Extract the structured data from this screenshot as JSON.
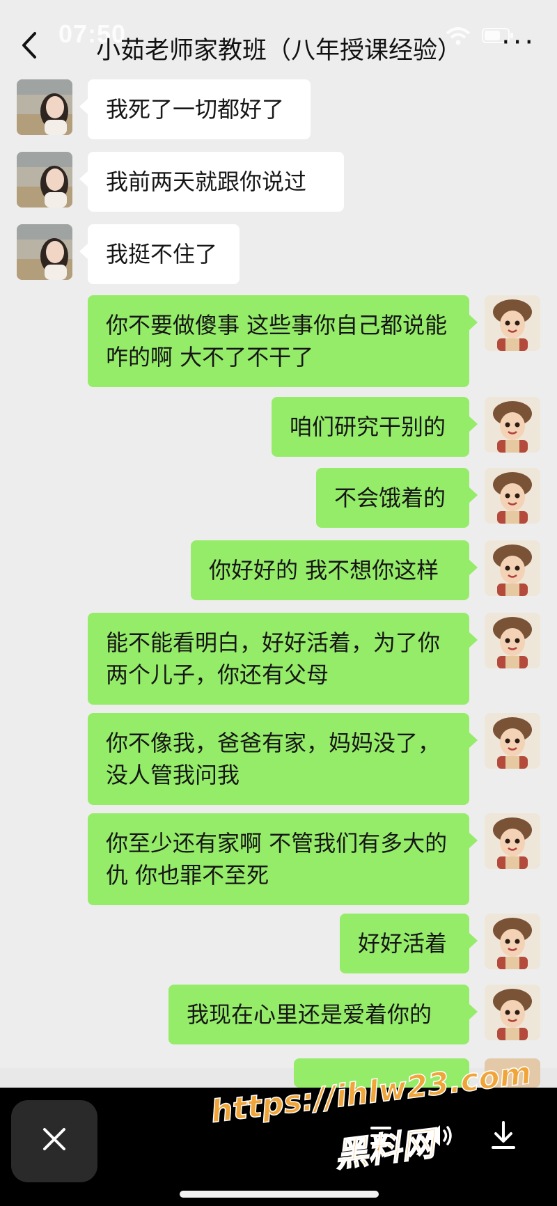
{
  "status": {
    "time": "07:50"
  },
  "header": {
    "title": "小茹老师家教班（八年授课经验）",
    "more": "···"
  },
  "messages": [
    {
      "side": "left",
      "text": "我死了一切都好了"
    },
    {
      "side": "left",
      "text": "我前两天就跟你说过"
    },
    {
      "side": "left",
      "text": "我挺不住了"
    },
    {
      "side": "right",
      "text": "你不要做傻事 这些事你自己都说能咋的啊 大不了不干了"
    },
    {
      "side": "right",
      "text": "咱们研究干别的"
    },
    {
      "side": "right",
      "text": "不会饿着的"
    },
    {
      "side": "right",
      "text": "你好好的 我不想你这样"
    },
    {
      "side": "right",
      "text": "能不能看明白，好好活着，为了你两个儿子，你还有父母"
    },
    {
      "side": "right",
      "text": "你不像我，爸爸有家，妈妈没了，没人管我问我"
    },
    {
      "side": "right",
      "text": "你至少还有家啊 不管我们有多大的仇 你也罪不至死"
    },
    {
      "side": "right",
      "text": "好好活着"
    },
    {
      "side": "right",
      "text": "我现在心里还是爱着你的"
    }
  ],
  "watermark": {
    "url": "https://ihlw23.com",
    "name": "黑料网"
  },
  "colors": {
    "self_bubble": "#95ec69",
    "other_bubble": "#ffffff",
    "background": "#ededed"
  }
}
